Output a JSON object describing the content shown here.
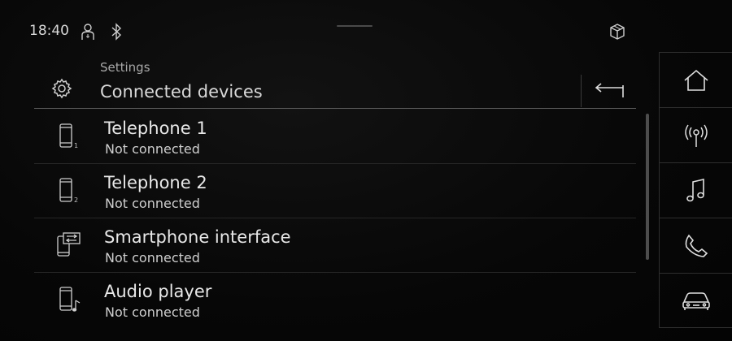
{
  "status_bar": {
    "time": "18:40",
    "icons": [
      "person-icon",
      "bluetooth-icon",
      "cube-icon"
    ]
  },
  "header": {
    "breadcrumb": "Settings",
    "title": "Connected devices",
    "icon": "gear-icon",
    "back_icon": "back-arrow-icon"
  },
  "devices": [
    {
      "title": "Telephone 1",
      "status": "Not connected",
      "icon": "phone-1-icon"
    },
    {
      "title": "Telephone 2",
      "status": "Not connected",
      "icon": "phone-2-icon"
    },
    {
      "title": "Smartphone interface",
      "status": "Not connected",
      "icon": "smartphone-interface-icon"
    },
    {
      "title": "Audio player",
      "status": "Not connected",
      "icon": "audio-player-icon"
    }
  ],
  "nav": [
    {
      "icon": "home-icon"
    },
    {
      "icon": "radio-icon"
    },
    {
      "icon": "music-icon"
    },
    {
      "icon": "phone-icon"
    },
    {
      "icon": "car-icon"
    }
  ],
  "colors": {
    "background": "#060606",
    "text": "#e6e6e6",
    "divider": "#262626"
  }
}
